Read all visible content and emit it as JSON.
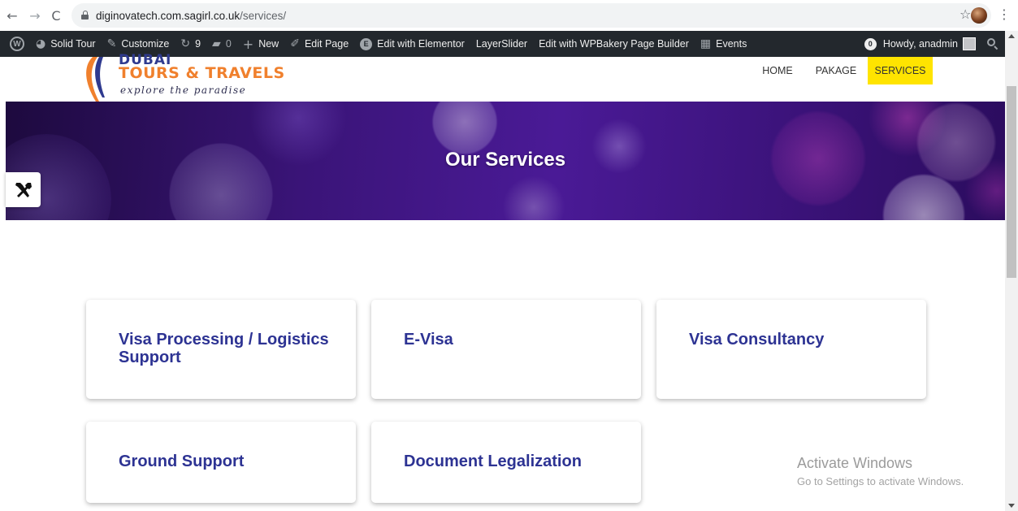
{
  "browser": {
    "url_host": "diginovatech.com.sagirl.co.uk",
    "url_path": "/services/"
  },
  "admin_bar": {
    "site_name": "Solid Tour",
    "customize": "Customize",
    "updates_count": "9",
    "comments_count": "0",
    "new": "New",
    "edit_page": "Edit Page",
    "edit_elementor": "Edit with Elementor",
    "layerslider": "LayerSlider",
    "edit_wpbakery": "Edit with WPBakery Page Builder",
    "events": "Events",
    "notifications_count": "0",
    "howdy": "Howdy, anadmin"
  },
  "site": {
    "logo_name": "TOURS & TRAVELS",
    "logo_tagline": "explore the paradise",
    "nav": [
      "HOME",
      "PAKAGE",
      "SERVICES"
    ]
  },
  "hero": {
    "title": "Our Services"
  },
  "services": [
    "Visa Processing / Logistics Support",
    "E-Visa",
    "Visa Consultancy",
    "Ground Support",
    "Document Legalization"
  ],
  "watermark": {
    "title": "Activate Windows",
    "subtitle": "Go to Settings to activate Windows."
  },
  "colors": {
    "accent_nav": "#ffe400",
    "card_title": "#2d3393",
    "admin_bar": "#23282d",
    "logo_orange": "#f0802d"
  }
}
